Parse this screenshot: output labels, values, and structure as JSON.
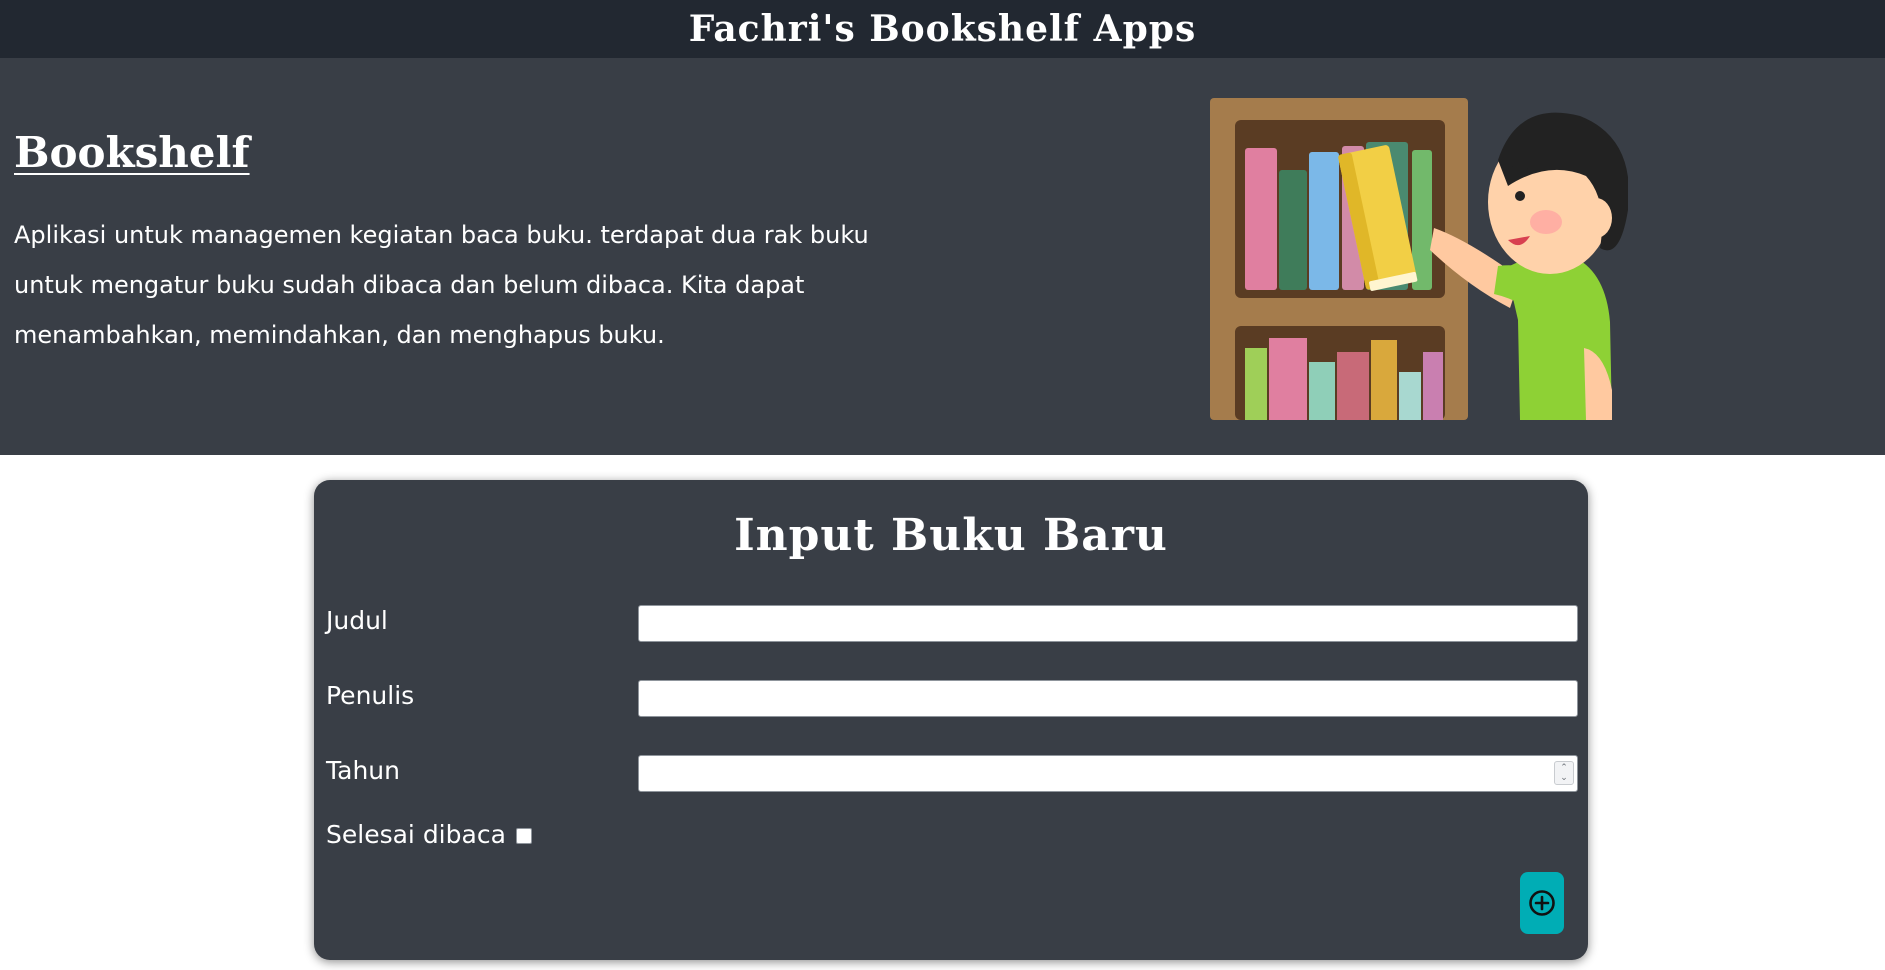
{
  "header": {
    "app_title": "Fachri's Bookshelf Apps"
  },
  "hero": {
    "title": "Bookshelf",
    "description": "Aplikasi untuk managemen kegiatan baca buku. terdapat dua rak buku untuk mengatur buku sudah dibaca dan belum dibaca. Kita dapat menambahkan, memindahkan, dan menghapus buku."
  },
  "form": {
    "title": "Input Buku Baru",
    "fields": {
      "judul": {
        "label": "Judul",
        "value": ""
      },
      "penulis": {
        "label": "Penulis",
        "value": ""
      },
      "tahun": {
        "label": "Tahun",
        "value": ""
      }
    },
    "checkbox": {
      "label": "Selesai dibaca",
      "checked": false
    },
    "submit_icon": "plus-circle-icon"
  },
  "colors": {
    "topbar": "#222831",
    "panel": "#393e46",
    "accent": "#00adb5",
    "text": "#ffffff"
  }
}
